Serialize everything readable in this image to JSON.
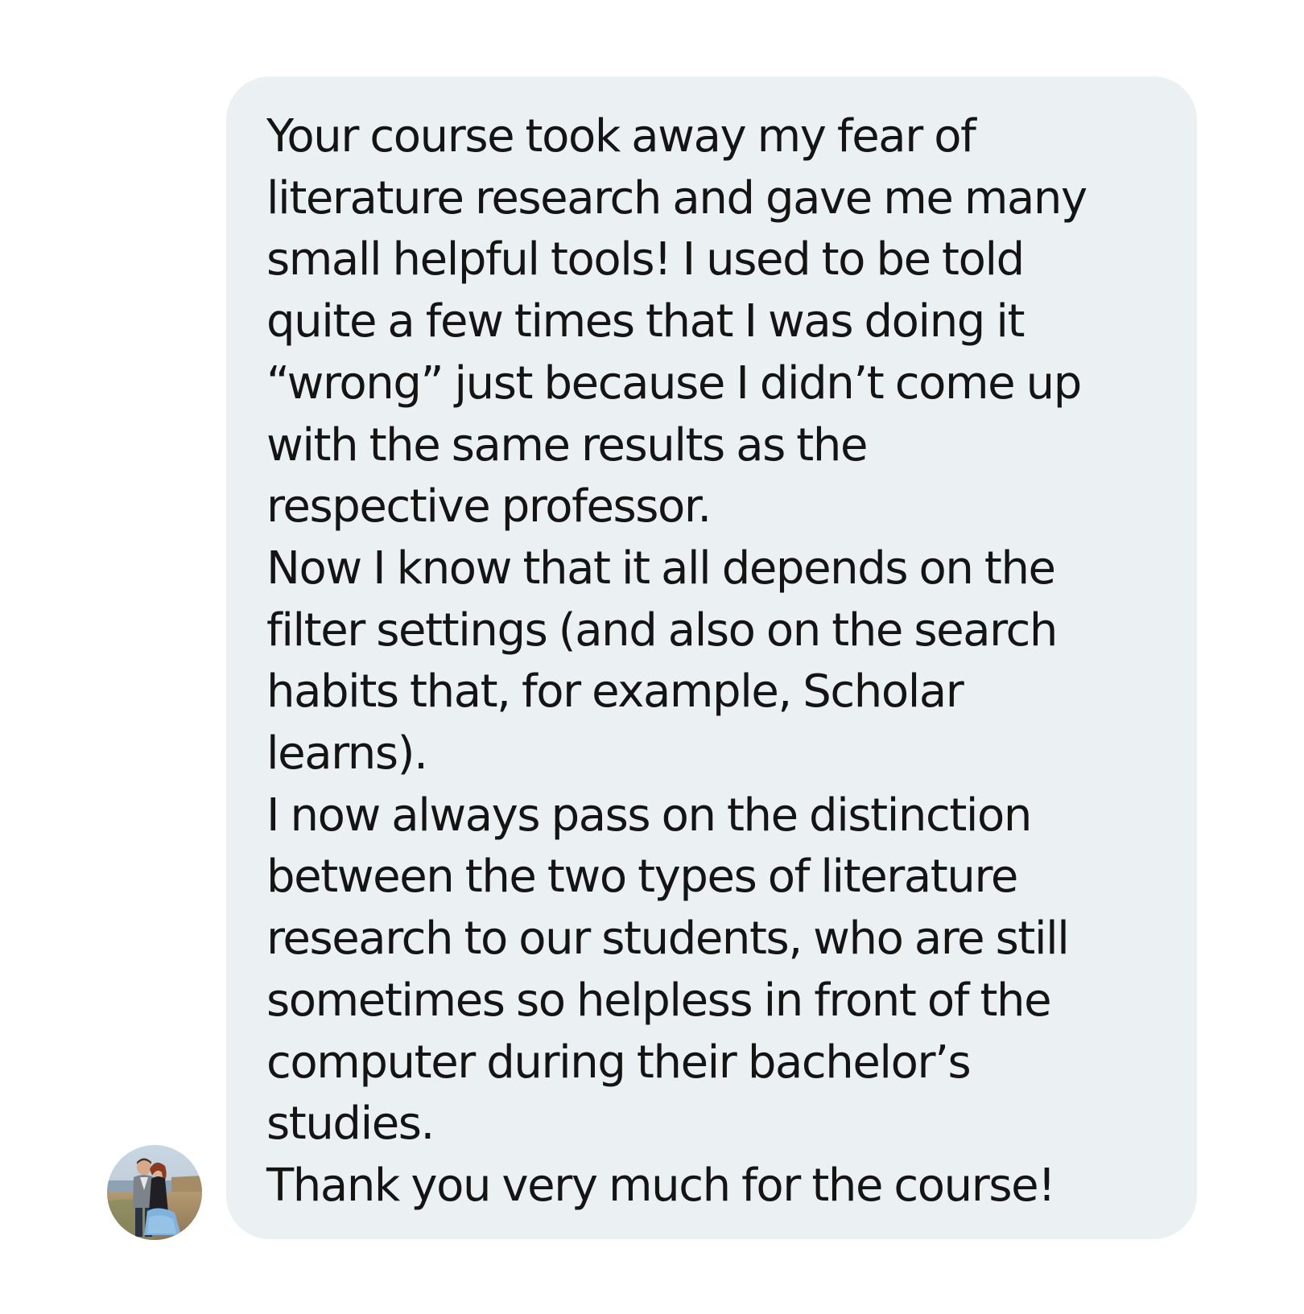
{
  "message": {
    "lines": [
      "Your course took away my fear of",
      "literature research and gave me many",
      "small helpful tools! I used to be told",
      "quite a few times that I was doing it",
      "“wrong” just because I didn’t come up",
      "with the same results as the",
      "respective professor.",
      "Now I know that it all depends on the",
      "filter settings (and also on the search",
      "habits that, for example, Scholar",
      "learns).",
      "I now always pass on the distinction",
      "between the two types of literature",
      "research to our students, who are still",
      "sometimes so helpless in front of the",
      "computer during their bachelor’s",
      "studies.",
      "Thank you very much for the course!"
    ]
  },
  "colors": {
    "bubble": "#ebf0f3",
    "text": "#141414",
    "background": "#ffffff"
  },
  "icons": {
    "avatar": "avatar-photo-icon"
  }
}
